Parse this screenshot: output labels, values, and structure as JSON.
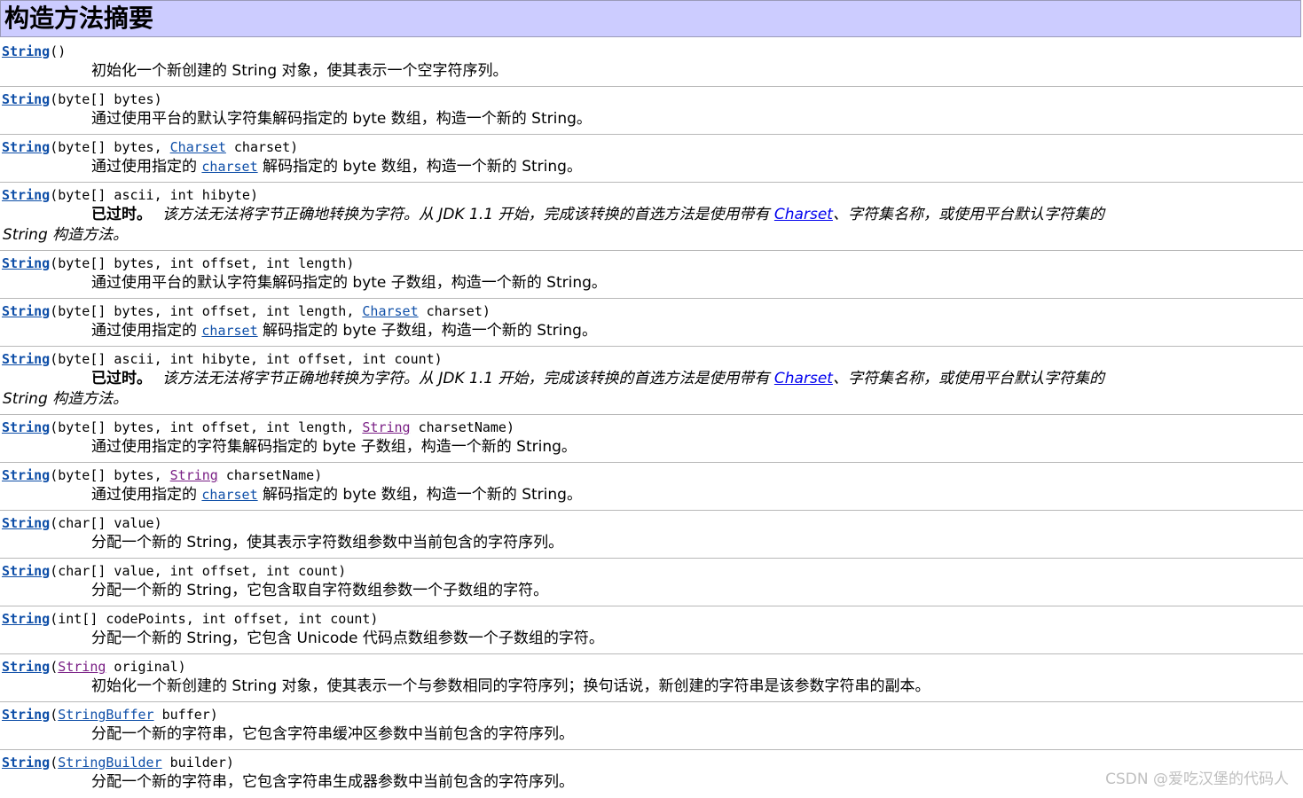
{
  "header": {
    "title": "构造方法摘要"
  },
  "ctor_name": "String",
  "rows": [
    {
      "sig_params": "()",
      "desc": "初始化一个新创建的 String 对象，使其表示一个空字符序列。"
    },
    {
      "sig_params": "(byte[] bytes)",
      "desc": "通过使用平台的默认字符集解码指定的 byte 数组，构造一个新的 String。"
    },
    {
      "sig_pre": "(byte[] bytes, ",
      "sig_link": "Charset",
      "sig_post": " charset)",
      "desc_pre": "通过使用指定的 ",
      "desc_link": "charset",
      "desc_post": " 解码指定的 byte 数组，构造一个新的 String。"
    },
    {
      "sig_params": "(byte[] ascii, int hibyte)",
      "deprecated_label": "已过时。",
      "dep_text_pre": "该方法无法将字节正确地转换为字符。从 JDK 1.1 开始，完成该转换的首选方法是使用带有 ",
      "dep_link": "Charset",
      "dep_text_post": "、字符集名称，或使用平台默认字符集的",
      "dep_line2": "String 构造方法。"
    },
    {
      "sig_params": "(byte[] bytes, int offset, int length)",
      "desc": "通过使用平台的默认字符集解码指定的 byte 子数组，构造一个新的 String。"
    },
    {
      "sig_pre": "(byte[] bytes, int offset, int length, ",
      "sig_link": "Charset",
      "sig_post": " charset)",
      "desc_pre": "通过使用指定的 ",
      "desc_link": "charset",
      "desc_post": " 解码指定的 byte 子数组，构造一个新的 String。"
    },
    {
      "sig_params": "(byte[] ascii, int hibyte, int offset, int count)",
      "deprecated_label": "已过时。",
      "dep_text_pre": "该方法无法将字节正确地转换为字符。从 JDK 1.1 开始，完成该转换的首选方法是使用带有 ",
      "dep_link": "Charset",
      "dep_text_post": "、字符集名称，或使用平台默认字符集的",
      "dep_line2": "String 构造方法。"
    },
    {
      "sig_pre": "(byte[] bytes, int offset, int length, ",
      "sig_link": "String",
      "sig_post": " charsetName)",
      "desc": "通过使用指定的字符集解码指定的 byte 子数组，构造一个新的 String。"
    },
    {
      "sig_pre": "(byte[] bytes, ",
      "sig_link": "String",
      "sig_post": " charsetName)",
      "desc_pre": "通过使用指定的 ",
      "desc_link": "charset",
      "desc_post": " 解码指定的 byte 数组，构造一个新的 String。"
    },
    {
      "sig_params": "(char[] value)",
      "desc": "分配一个新的 String，使其表示字符数组参数中当前包含的字符序列。"
    },
    {
      "sig_params": "(char[] value, int offset, int count)",
      "desc": "分配一个新的 String，它包含取自字符数组参数一个子数组的字符。"
    },
    {
      "sig_params": "(int[] codePoints, int offset, int count)",
      "desc": "分配一个新的 String，它包含 Unicode 代码点数组参数一个子数组的字符。"
    },
    {
      "sig_pre": "(",
      "sig_link": "String",
      "sig_post": " original)",
      "desc": "初始化一个新创建的 String 对象，使其表示一个与参数相同的字符序列；换句话说，新创建的字符串是该参数字符串的副本。"
    },
    {
      "sig_pre": "(",
      "sig_link": "StringBuffer",
      "sig_post": " buffer)",
      "desc": "分配一个新的字符串，它包含字符串缓冲区参数中当前包含的字符序列。"
    },
    {
      "sig_pre": "(",
      "sig_link": "StringBuilder",
      "sig_post": " builder)",
      "desc": "分配一个新的字符串，它包含字符串生成器参数中当前包含的字符序列。"
    }
  ],
  "watermark": "CSDN @爱吃汉堡的代码人"
}
